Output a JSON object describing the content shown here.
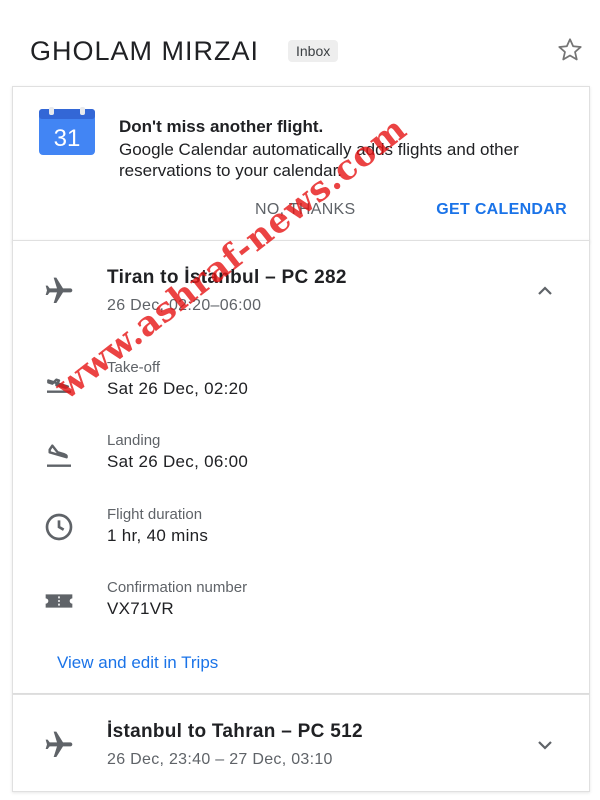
{
  "header": {
    "sender": "GHOLAM MIRZAI",
    "label": "Inbox",
    "star_icon": "star-outline-icon"
  },
  "promo": {
    "icon": "google-calendar-icon",
    "calendar_day": "31",
    "title": "Don't miss another flight.",
    "body": "Google Calendar automatically adds flights and other reservations to your calendar.",
    "dismiss_label": "NO, THANKS",
    "action_label": "GET CALENDAR"
  },
  "flights": [
    {
      "icon": "airplane-icon",
      "title": "Tiran to İstanbul – PC 282",
      "time": "26 Dec, 02:20–06:00",
      "expanded": true,
      "details": [
        {
          "icon": "takeoff-icon",
          "label": "Take-off",
          "value": "Sat 26 Dec, 02:20"
        },
        {
          "icon": "landing-icon",
          "label": "Landing",
          "value": "Sat 26 Dec, 06:00"
        },
        {
          "icon": "clock-icon",
          "label": "Flight duration",
          "value": "1 hr, 40 mins"
        },
        {
          "icon": "ticket-icon",
          "label": "Confirmation number",
          "value": "VX71VR"
        }
      ],
      "link_label": "View and edit in Trips"
    },
    {
      "icon": "airplane-icon",
      "title": "İstanbul to Tahran – PC 512",
      "time": "26 Dec, 23:40 – 27 Dec, 03:10",
      "expanded": false
    }
  ],
  "watermark": "www.ashraf-news.com",
  "colors": {
    "accent_blue": "#1a73e8",
    "calendar_blue": "#4285f4",
    "watermark_red": "#e61414",
    "icon_gray": "#5f6368"
  }
}
